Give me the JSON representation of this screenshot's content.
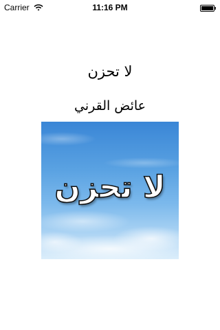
{
  "status_bar": {
    "carrier": "Carrier",
    "time": "11:16 PM",
    "wifi_icon": "wifi-icon",
    "battery_icon": "battery-icon"
  },
  "book": {
    "title": "لا تحزن",
    "author": "عائض القرني",
    "cover_text": "لا تحزن",
    "cover_sky_color": "#5aa2e2"
  }
}
